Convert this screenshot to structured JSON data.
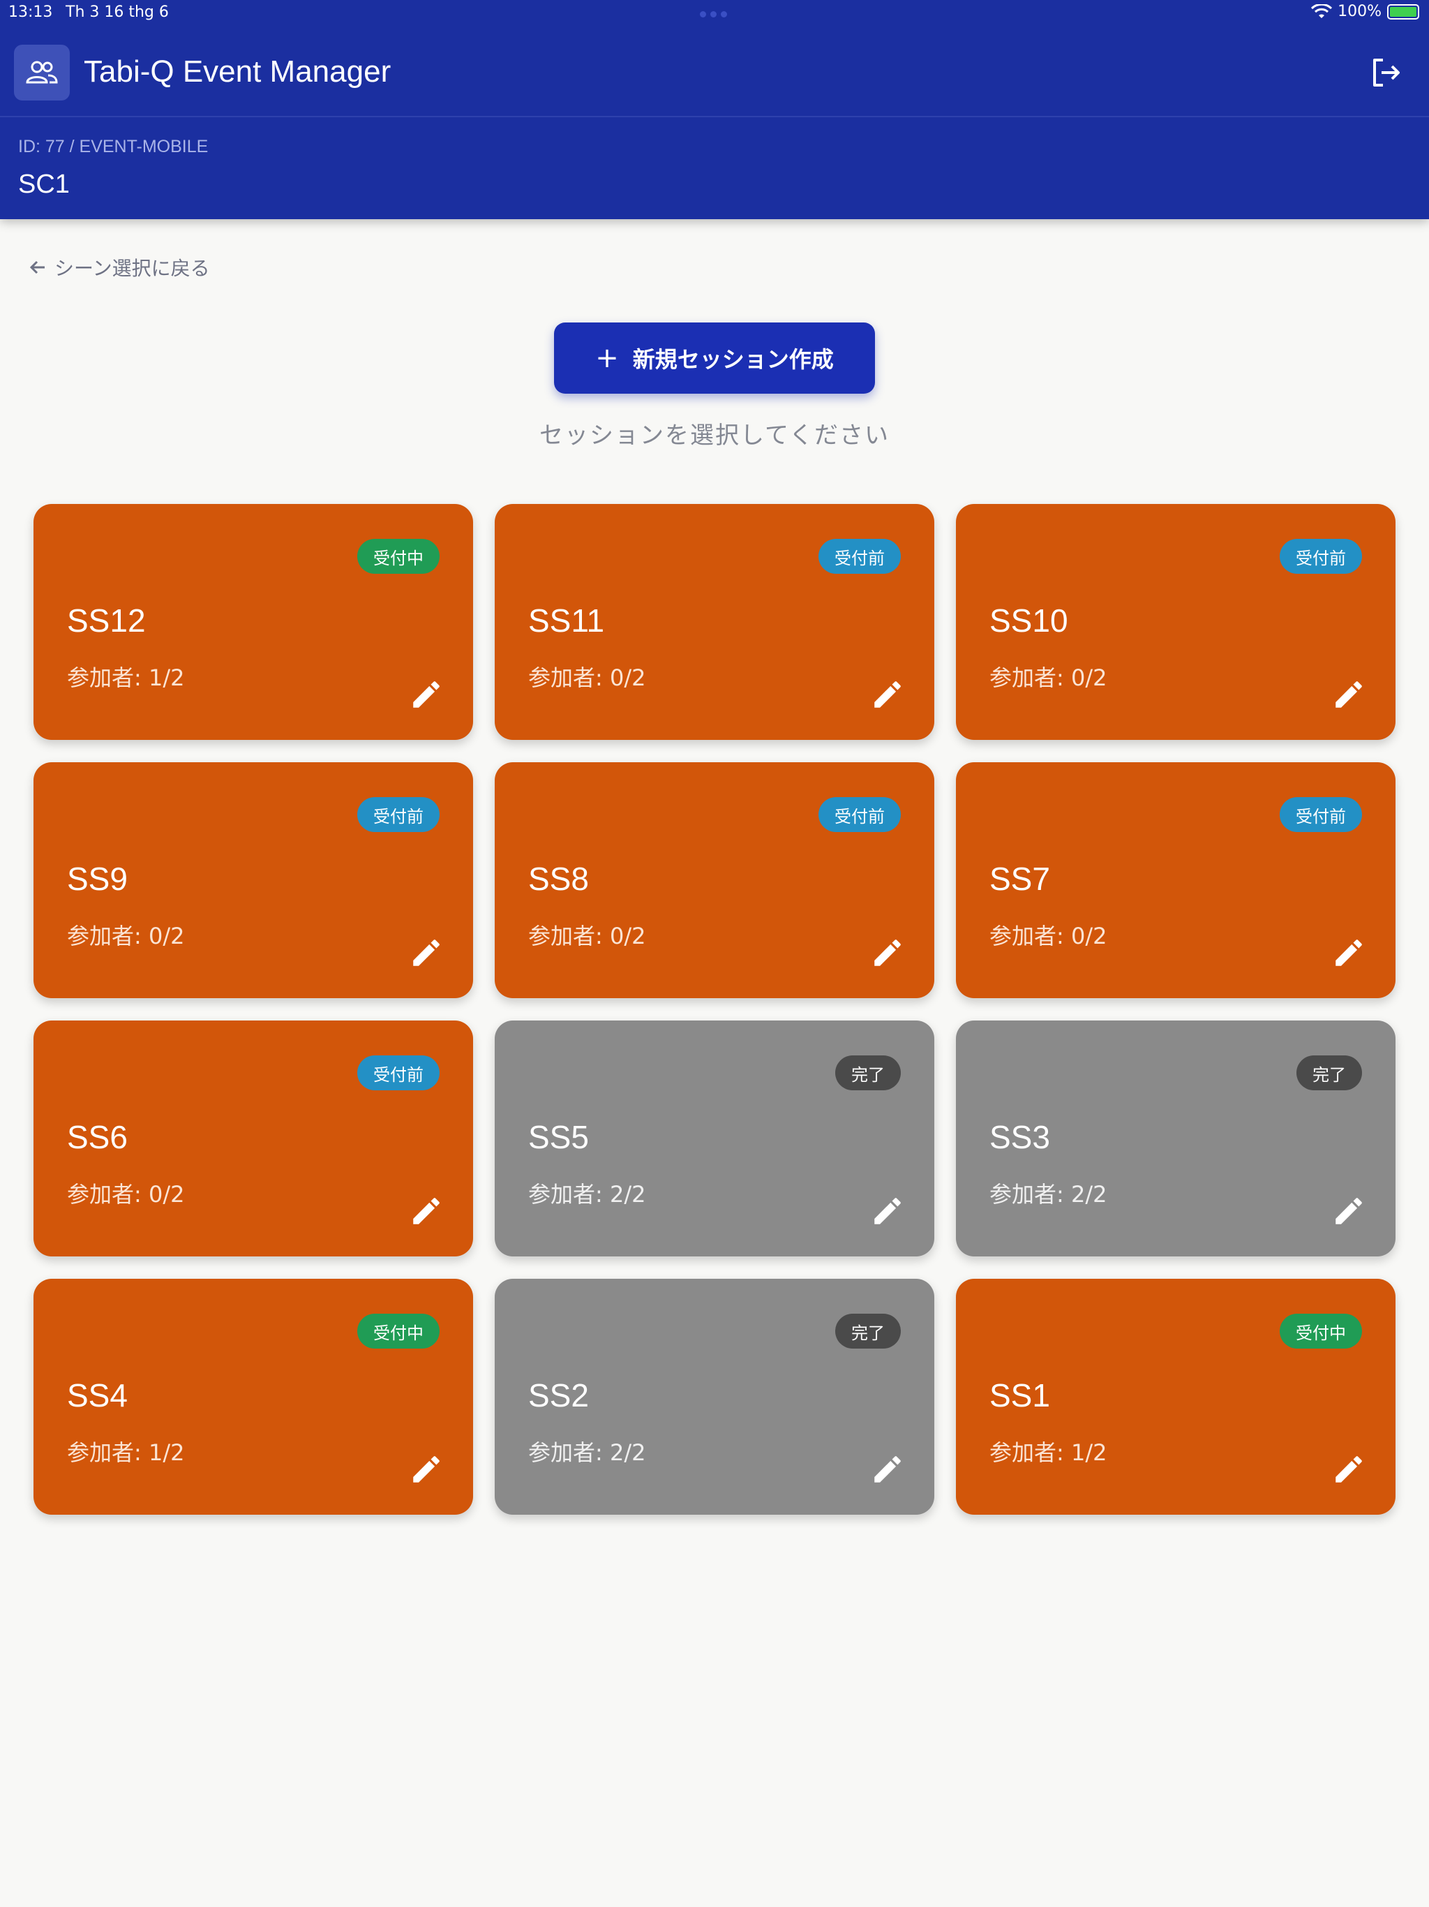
{
  "status_bar": {
    "time": "13:13",
    "date": "Th 3 16 thg 6",
    "battery": "100%"
  },
  "app": {
    "title": "Tabi-Q Event Manager"
  },
  "event": {
    "id_line": "ID: 77 / EVENT-MOBILE",
    "name": "SC1"
  },
  "back_link": "シーン選択に戻る",
  "create_button": "新規セッション作成",
  "prompt": "セッションを選択してください",
  "colors": {
    "header": "#1b2fa0",
    "card_active": "#d2560a",
    "card_done": "#8a8a8a",
    "badge_open": "#209c55",
    "badge_before": "#2390c5",
    "badge_done": "#4a4a4a"
  },
  "sessions": [
    {
      "name": "SS12",
      "status": "受付中",
      "participants": "参加者: 1/2"
    },
    {
      "name": "SS11",
      "status": "受付前",
      "participants": "参加者: 0/2"
    },
    {
      "name": "SS10",
      "status": "受付前",
      "participants": "参加者: 0/2"
    },
    {
      "name": "SS9",
      "status": "受付前",
      "participants": "参加者: 0/2"
    },
    {
      "name": "SS8",
      "status": "受付前",
      "participants": "参加者: 0/2"
    },
    {
      "name": "SS7",
      "status": "受付前",
      "participants": "参加者: 0/2"
    },
    {
      "name": "SS6",
      "status": "受付前",
      "participants": "参加者: 0/2"
    },
    {
      "name": "SS5",
      "status": "完了",
      "participants": "参加者: 2/2"
    },
    {
      "name": "SS3",
      "status": "完了",
      "participants": "参加者: 2/2"
    },
    {
      "name": "SS4",
      "status": "受付中",
      "participants": "参加者: 1/2"
    },
    {
      "name": "SS2",
      "status": "完了",
      "participants": "参加者: 2/2"
    },
    {
      "name": "SS1",
      "status": "受付中",
      "participants": "参加者: 1/2"
    }
  ]
}
